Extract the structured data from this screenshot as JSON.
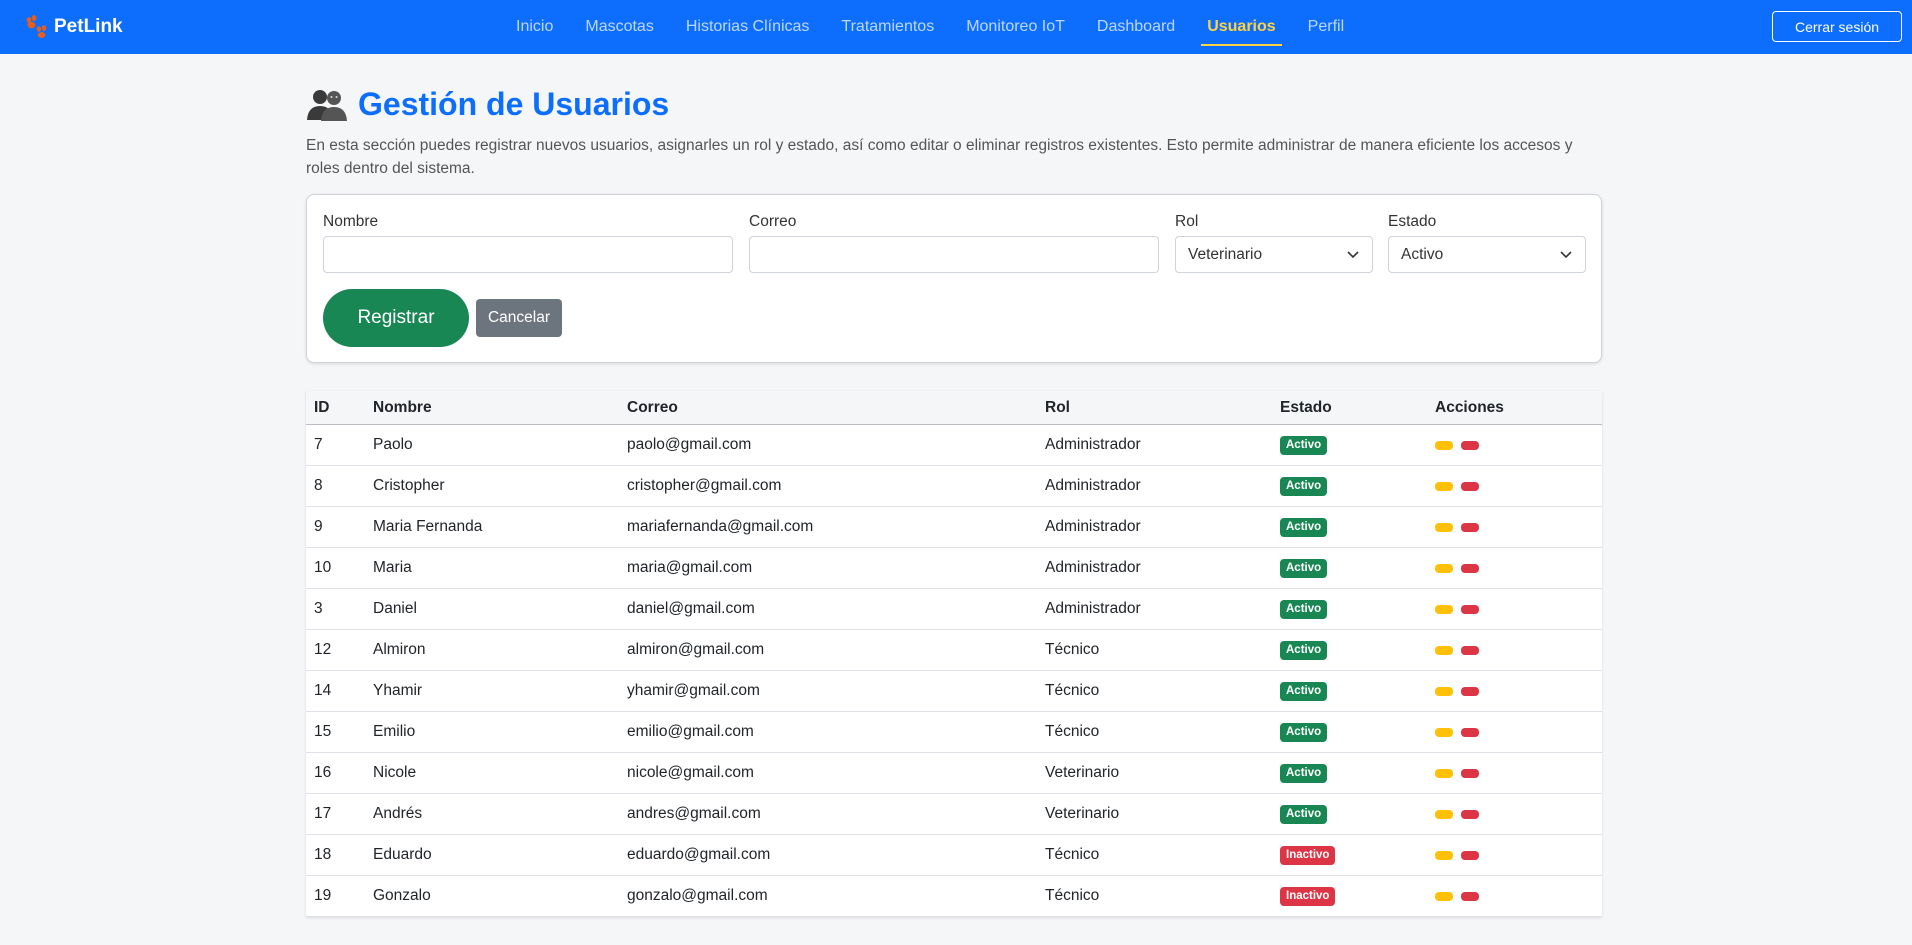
{
  "brand": {
    "name": "PetLink",
    "icon": "paw-icon"
  },
  "nav": {
    "items": [
      {
        "label": "Inicio",
        "active": false
      },
      {
        "label": "Mascotas",
        "active": false
      },
      {
        "label": "Historias Clínicas",
        "active": false
      },
      {
        "label": "Tratamientos",
        "active": false
      },
      {
        "label": "Monitoreo IoT",
        "active": false
      },
      {
        "label": "Dashboard",
        "active": false
      },
      {
        "label": "Usuarios",
        "active": true
      },
      {
        "label": "Perfil",
        "active": false
      }
    ],
    "logout_label": "Cerrar sesión"
  },
  "page": {
    "title": "Gestión de Usuarios",
    "title_icon": "users-icon",
    "description": "En esta sección puedes registrar nuevos usuarios, asignarles un rol y estado, así como editar o eliminar registros existentes. Esto permite administrar de manera eficiente los accesos y roles dentro del sistema."
  },
  "form": {
    "name_label": "Nombre",
    "name_value": "",
    "email_label": "Correo",
    "email_value": "",
    "role_label": "Rol",
    "role_value": "Veterinario",
    "status_label": "Estado",
    "status_value": "Activo",
    "register_label": "Registrar",
    "cancel_label": "Cancelar"
  },
  "table": {
    "headers": [
      "ID",
      "Nombre",
      "Correo",
      "Rol",
      "Estado",
      "Acciones"
    ],
    "rows": [
      {
        "id": "7",
        "name": "Paolo",
        "email": "paolo@gmail.com",
        "role": "Administrador",
        "status": "Activo"
      },
      {
        "id": "8",
        "name": "Cristopher",
        "email": "cristopher@gmail.com",
        "role": "Administrador",
        "status": "Activo"
      },
      {
        "id": "9",
        "name": "Maria Fernanda",
        "email": "mariafernanda@gmail.com",
        "role": "Administrador",
        "status": "Activo"
      },
      {
        "id": "10",
        "name": "Maria",
        "email": "maria@gmail.com",
        "role": "Administrador",
        "status": "Activo"
      },
      {
        "id": "3",
        "name": "Daniel",
        "email": "daniel@gmail.com",
        "role": "Administrador",
        "status": "Activo"
      },
      {
        "id": "12",
        "name": "Almiron",
        "email": "almiron@gmail.com",
        "role": "Técnico",
        "status": "Activo"
      },
      {
        "id": "14",
        "name": "Yhamir",
        "email": "yhamir@gmail.com",
        "role": "Técnico",
        "status": "Activo"
      },
      {
        "id": "15",
        "name": "Emilio",
        "email": "emilio@gmail.com",
        "role": "Técnico",
        "status": "Activo"
      },
      {
        "id": "16",
        "name": "Nicole",
        "email": "nicole@gmail.com",
        "role": "Veterinario",
        "status": "Activo"
      },
      {
        "id": "17",
        "name": "Andrés",
        "email": "andres@gmail.com",
        "role": "Veterinario",
        "status": "Activo"
      },
      {
        "id": "18",
        "name": "Eduardo",
        "email": "eduardo@gmail.com",
        "role": "Técnico",
        "status": "Inactivo"
      },
      {
        "id": "19",
        "name": "Gonzalo",
        "email": "gonzalo@gmail.com",
        "role": "Técnico",
        "status": "Inactivo"
      }
    ]
  },
  "colors": {
    "primary": "#0d6efd",
    "active_nav": "#ffd23f",
    "success": "#198754",
    "danger": "#dc3545",
    "warning": "#ffc107",
    "secondary": "#6c757d"
  }
}
